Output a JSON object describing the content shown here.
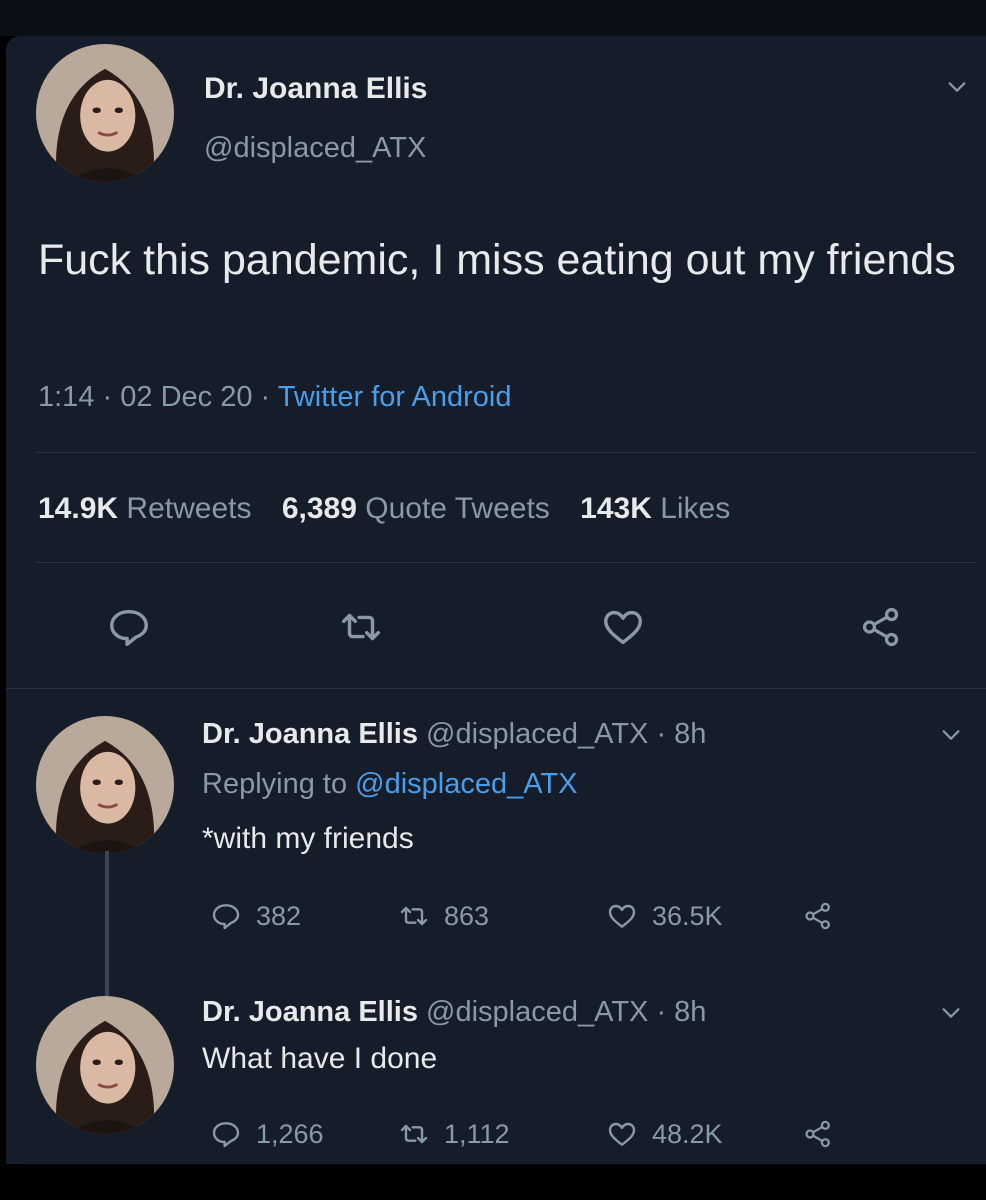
{
  "main_tweet": {
    "display_name": "Dr. Joanna Ellis",
    "handle": "@displaced_ATX",
    "text": "Fuck this pandemic, I miss eating out my friends",
    "time": "1:14",
    "date": "02 Dec 20",
    "sep": "·",
    "source": "Twitter for Android",
    "stats": {
      "retweets_count": "14.9K",
      "retweets_label": "Retweets",
      "quotes_count": "6,389",
      "quotes_label": "Quote Tweets",
      "likes_count": "143K",
      "likes_label": "Likes"
    },
    "icons": [
      "reply-icon",
      "retweet-icon",
      "like-icon",
      "share-icon",
      "chevron-down-icon"
    ]
  },
  "replies": [
    {
      "display_name": "Dr. Joanna Ellis",
      "handle": "@displaced_ATX",
      "age": "· 8h",
      "replying_prefix": "Replying to",
      "replying_handle": "@displaced_ATX",
      "text": "*with my friends",
      "replies": "382",
      "retweets": "863",
      "likes": "36.5K"
    },
    {
      "display_name": "Dr. Joanna Ellis",
      "handle": "@displaced_ATX",
      "age": "· 8h",
      "text": "What have I done",
      "replies": "1,266",
      "retweets": "1,112",
      "likes": "48.2K"
    }
  ],
  "colors": {
    "background": "#151c2a",
    "text": "#e7e9ea",
    "muted": "#8b98a5",
    "link": "#4a9ee8"
  }
}
